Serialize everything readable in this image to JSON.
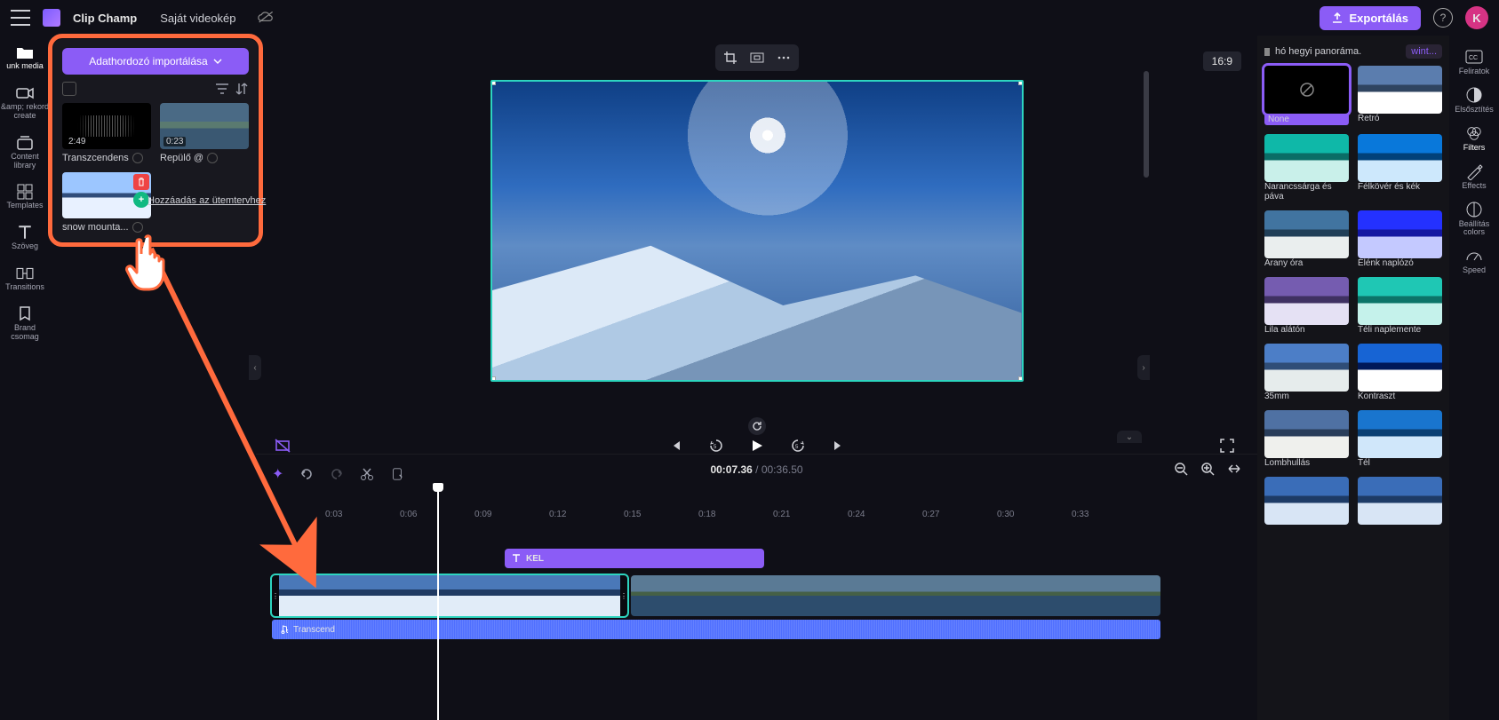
{
  "app": {
    "brand": "Clip Champ",
    "project": "Saját videokép"
  },
  "topbar": {
    "export": "Exportálás",
    "help": "?",
    "avatar": "K"
  },
  "leftnav": [
    {
      "id": "media",
      "label": "unk  media"
    },
    {
      "id": "record",
      "label": "&amp; rekord\ncreate"
    },
    {
      "id": "library",
      "label": "Content\nlibrary"
    },
    {
      "id": "templates",
      "label": "Templates"
    },
    {
      "id": "text",
      "label": "Szöveg"
    },
    {
      "id": "transitions",
      "label": "Transitions"
    },
    {
      "id": "brand",
      "label": "Brand csomag"
    }
  ],
  "media": {
    "import": "Adathordozó importálása",
    "tooltip": "Hozzáadás az ütemtervhez",
    "clips": [
      {
        "name": "Transzcendens",
        "duration": "2:49",
        "kind": "audio"
      },
      {
        "name": "Repülő @",
        "duration": "0:23",
        "kind": "lake"
      },
      {
        "name": "snow mounta...",
        "duration": "",
        "kind": "snow",
        "selected": true
      }
    ]
  },
  "preview": {
    "aspect": "16:9"
  },
  "timeline": {
    "current": "00:07.36",
    "total": "00:36.50",
    "ticks": [
      "0:03",
      "0:06",
      "0:09",
      "0:12",
      "0:15",
      "0:18",
      "0:21",
      "0:24",
      "0:27",
      "0:30",
      "0:33"
    ],
    "text_clip": "KEL",
    "audio_clip": "Transcend"
  },
  "filters": {
    "keyword": "hó hegyi panoráma.",
    "project": "wint...",
    "items": [
      {
        "name": "None",
        "selected": true
      },
      {
        "name": "Retró",
        "cls": "ft-retro"
      },
      {
        "name": "Narancssárga és páva",
        "cls": "ft-orange"
      },
      {
        "name": "Félkövér és kék",
        "cls": "ft-bold"
      },
      {
        "name": "Arany óra",
        "cls": "ft-golden"
      },
      {
        "name": "Élénk naplózó",
        "cls": "ft-vivid"
      },
      {
        "name": "Lila alátón",
        "cls": "ft-lilac"
      },
      {
        "name": "Téli naplemente",
        "cls": "ft-winter"
      },
      {
        "name": "35mm",
        "cls": "ft-35mm"
      },
      {
        "name": "Kontraszt",
        "cls": "ft-contrast"
      },
      {
        "name": "Lombhullás",
        "cls": "ft-fall"
      },
      {
        "name": "Tél",
        "cls": "ft-tel"
      },
      {
        "name": "",
        "cls": ""
      },
      {
        "name": "",
        "cls": ""
      }
    ]
  },
  "rightnav": [
    {
      "id": "captions",
      "label": "Feliratok"
    },
    {
      "id": "fade",
      "label": "Elsősztítés"
    },
    {
      "id": "filters",
      "label": "Filters",
      "active": true
    },
    {
      "id": "effects",
      "label": "Effects"
    },
    {
      "id": "adjust",
      "label": "Beállítás\ncolors"
    },
    {
      "id": "speed",
      "label": "Speed"
    }
  ]
}
